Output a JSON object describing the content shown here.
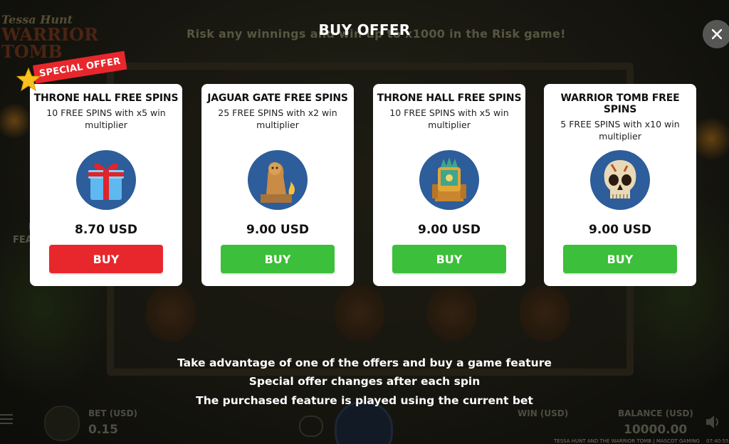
{
  "background": {
    "logo": {
      "line1": "Tessa Hunt",
      "line2": "WARRIOR",
      "line3": "TOMB"
    },
    "risk_banner": "Risk any winnings and win up to x1000 in the Risk game!",
    "side_text_1": "B",
    "side_text_2": "FEA"
  },
  "dialog": {
    "title": "BUY OFFER",
    "special_badge": "SPECIAL OFFER",
    "offers": [
      {
        "name": "THRONE HALL FREE SPINS",
        "description": "10 FREE SPINS with x5 win multiplier",
        "price": "8.70 USD",
        "button": "BUY",
        "icon": "gift-box-icon",
        "accent": "#e8272c"
      },
      {
        "name": "JAGUAR GATE FREE SPINS",
        "description": "25 FREE SPINS with x2 win multiplier",
        "price": "9.00 USD",
        "button": "BUY",
        "icon": "jaguar-statue-icon",
        "accent": "#3cbf3a"
      },
      {
        "name": "THRONE HALL FREE SPINS",
        "description": "10 FREE SPINS with x5 win multiplier",
        "price": "9.00 USD",
        "button": "BUY",
        "icon": "throne-icon",
        "accent": "#3cbf3a"
      },
      {
        "name": "WARRIOR TOMB FREE SPINS",
        "description": "5 FREE SPINS with x10 win multiplier",
        "price": "9.00 USD",
        "button": "BUY",
        "icon": "skull-icon",
        "accent": "#3cbf3a"
      }
    ],
    "info_lines": [
      "Take advantage of one of the offers and buy a game feature",
      "Special offer changes after each spin",
      "The purchased feature is played using the current bet"
    ]
  },
  "bottom_bar": {
    "bet_label": "BET (USD)",
    "bet_value": "0.15",
    "win_label": "WIN (USD)",
    "balance_label": "BALANCE (USD)",
    "balance_value": "10000.00",
    "footer_game": "TESSA HUNT AND THE WARRIOR TOMB | MASCOT GAMING",
    "clock": "07:40:55"
  }
}
